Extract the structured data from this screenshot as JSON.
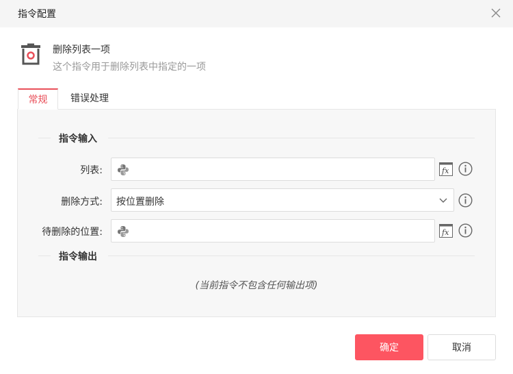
{
  "dialog": {
    "title": "指令配置",
    "close_icon": "close-icon"
  },
  "command": {
    "icon": "trash-icon",
    "name": "删除列表一项",
    "description": "这个指令用于删除列表中指定的一项",
    "accent_color": "#e94f59"
  },
  "tabs": [
    {
      "label": "常规",
      "active": true
    },
    {
      "label": "错误处理",
      "active": false
    }
  ],
  "inputs_section": {
    "title": "指令输入",
    "fields": [
      {
        "label": "列表:",
        "value": "",
        "type": "expression"
      },
      {
        "label": "删除方式:",
        "value": "按位置删除",
        "type": "select"
      },
      {
        "label": "待删除的位置:",
        "value": "",
        "type": "expression"
      }
    ]
  },
  "outputs_section": {
    "title": "指令输出",
    "empty_note": "(当前指令不包含任何输出项)"
  },
  "footer": {
    "ok_label": "确定",
    "cancel_label": "取消",
    "ok_color": "#fd5561"
  }
}
